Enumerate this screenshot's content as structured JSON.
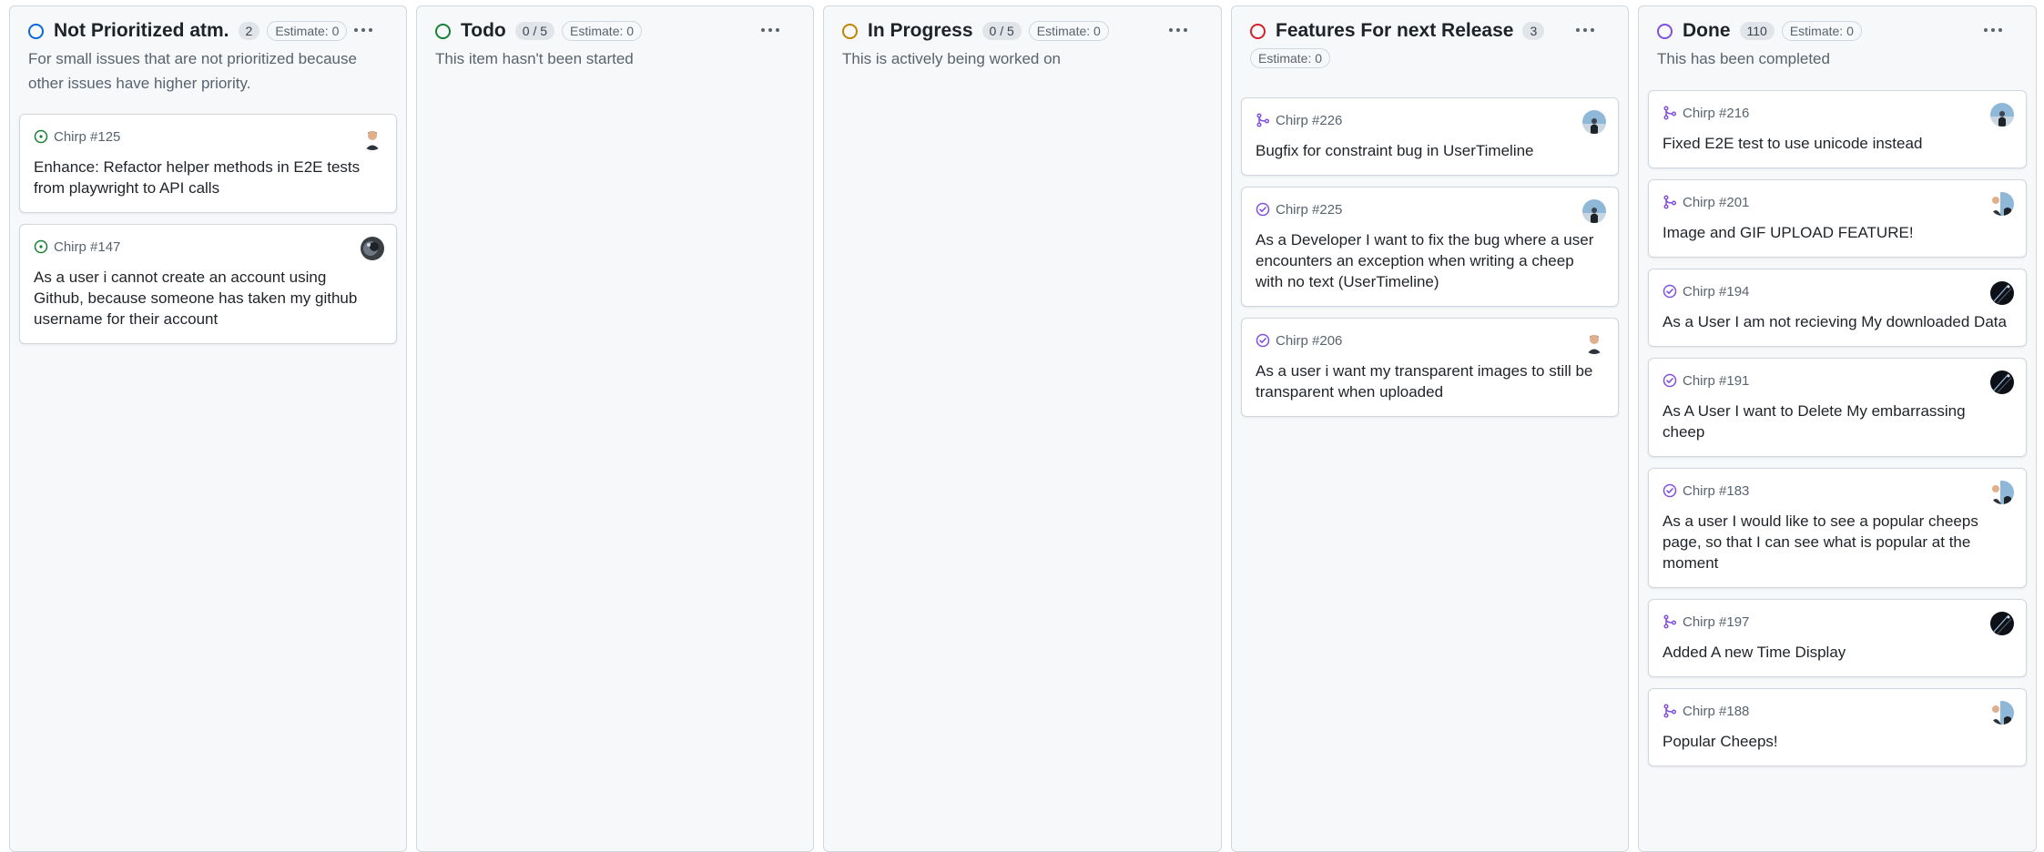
{
  "columns": [
    {
      "title": "Not Prioritized atm.",
      "status_color": "#0969da",
      "count": "2",
      "estimate": "Estimate: 0",
      "description": "For small issues that are not prioritized because other issues have higher priority.",
      "cards": [
        {
          "icon": "issue-open-icon",
          "ref": "Chirp #125",
          "title": "Enhance: Refactor helper methods in E2E tests from playwright to API calls",
          "avatar": "person"
        },
        {
          "icon": "issue-open-icon",
          "ref": "Chirp #147",
          "title": "As a user i cannot create an account using Github, because someone has taken my github username for their account",
          "avatar": "dark"
        }
      ]
    },
    {
      "title": "Todo",
      "status_color": "#1a7f37",
      "count": "0 / 5",
      "estimate": "Estimate: 0",
      "description": "This item hasn't been started",
      "cards": []
    },
    {
      "title": "In Progress",
      "status_color": "#bf8700",
      "count": "0 / 5",
      "estimate": "Estimate: 0",
      "description": "This is actively being worked on",
      "cards": []
    },
    {
      "title": "Features For next Release",
      "status_color": "#cf222e",
      "count": "3",
      "estimate": "Estimate: 0",
      "description": "",
      "cards": [
        {
          "icon": "pull-request-merged-icon",
          "ref": "Chirp #226",
          "title": "Bugfix for constraint bug in UserTimeline",
          "avatar": "sky"
        },
        {
          "icon": "issue-closed-icon",
          "ref": "Chirp #225",
          "title": "As a Developer I want to fix the bug where a user encounters an exception when writing a cheep with no text (UserTimeline)",
          "avatar": "sky"
        },
        {
          "icon": "issue-closed-icon",
          "ref": "Chirp #206",
          "title": "As a user i want my transparent images to still be transparent when uploaded",
          "avatar": "person"
        }
      ]
    },
    {
      "title": "Done",
      "status_color": "#8250df",
      "count": "110",
      "estimate": "Estimate: 0",
      "description": "This has been completed",
      "cards": [
        {
          "icon": "pull-request-merged-icon",
          "ref": "Chirp #216",
          "title": "Fixed E2E test to use unicode instead",
          "avatar": "sky"
        },
        {
          "icon": "pull-request-merged-icon",
          "ref": "Chirp #201",
          "title": "Image and GIF UPLOAD FEATURE!",
          "avatar": "pair"
        },
        {
          "icon": "issue-closed-icon",
          "ref": "Chirp #194",
          "title": "As a User I am not recieving My downloaded Data",
          "avatar": "night"
        },
        {
          "icon": "issue-closed-icon",
          "ref": "Chirp #191",
          "title": "As A User I want to Delete My embarrassing cheep",
          "avatar": "night"
        },
        {
          "icon": "issue-closed-icon",
          "ref": "Chirp #183",
          "title": "As a user I would like to see a popular cheeps page, so that I can see what is popular at the moment",
          "avatar": "pair"
        },
        {
          "icon": "pull-request-merged-icon",
          "ref": "Chirp #197",
          "title": "Added A new Time Display",
          "avatar": "night"
        },
        {
          "icon": "pull-request-merged-icon",
          "ref": "Chirp #188",
          "title": "Popular Cheeps!",
          "avatar": "pair"
        }
      ]
    }
  ],
  "icon_colors": {
    "issue-open-icon": "#1a7f37",
    "issue-closed-icon": "#8250df",
    "pull-request-merged-icon": "#8250df"
  }
}
